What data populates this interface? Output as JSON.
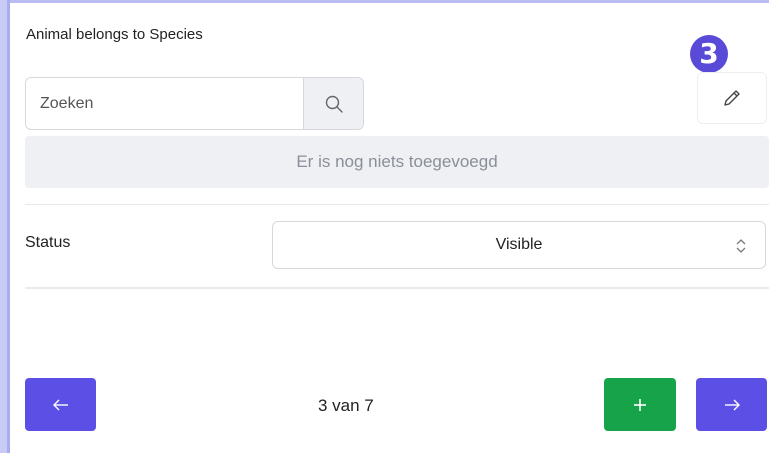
{
  "section": {
    "title": "Animal belongs to Species",
    "step_badge": "3"
  },
  "search": {
    "placeholder": "Zoeken",
    "value": "",
    "button_icon": "search-icon"
  },
  "edit": {
    "icon": "pencil-icon"
  },
  "list": {
    "empty_text": "Er is nog niets toegevoegd"
  },
  "status": {
    "label": "Status",
    "selected": "Visible",
    "icon": "updown-chevron-icon"
  },
  "footer": {
    "pagination": "3 van 7",
    "prev_icon": "arrow-left-icon",
    "add_icon": "plus-icon",
    "next_icon": "arrow-right-icon"
  },
  "colors": {
    "accent": "#5b4fe6",
    "add": "#17a34a",
    "badge": "#5a4ad8",
    "frame": "#b9bdf4",
    "empty_bg": "#eef0f3"
  }
}
